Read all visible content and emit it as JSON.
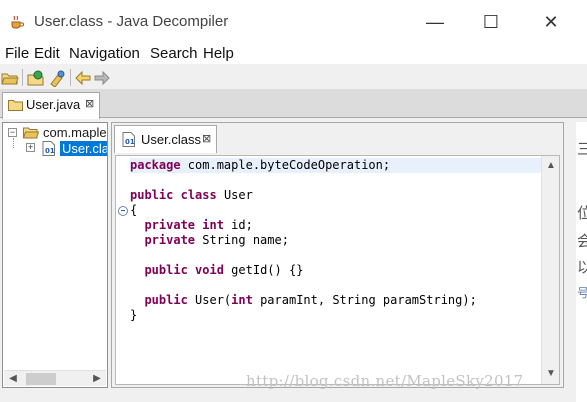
{
  "window": {
    "title": "User.class - Java Decompiler",
    "minimize": "—",
    "maximize": "☐",
    "close": "✕"
  },
  "menu": [
    "File",
    "Edit",
    "Navigation",
    "Search",
    "Help"
  ],
  "toolbar_icons": [
    "open-file-icon",
    "open-type-icon",
    "search-type-icon",
    "back-icon",
    "forward-icon"
  ],
  "editor_tab": {
    "label": "User.java",
    "close": "⊠"
  },
  "tree": {
    "package": "com.maple",
    "class_node": "User.class",
    "expander_collapsed": "+",
    "expander_expanded": "−"
  },
  "class_tab": {
    "label": "User.class",
    "close": "⊠"
  },
  "code": {
    "l1": {
      "kw": "package",
      "rest": " com.maple.byteCodeOperation;"
    },
    "l3": {
      "kw1": "public",
      "sp": " ",
      "kw2": "class",
      "rest": " User"
    },
    "l4": "{",
    "l5": {
      "indent": "  ",
      "kw1": "private",
      "sp": " ",
      "kw2": "int",
      "rest": " id;"
    },
    "l6": {
      "indent": "  ",
      "kw": "private",
      "rest": " String name;"
    },
    "l8": {
      "indent": "  ",
      "kw1": "public",
      "sp": " ",
      "kw2": "void",
      "rest": " getId() {}"
    },
    "l10": {
      "indent": "  ",
      "kw1": "public",
      "mid": " User(",
      "kw2": "int",
      "rest": " paramInt, String paramString);"
    },
    "l11": "}"
  },
  "scroll_arrows": {
    "up": "▲",
    "down": "▼",
    "left": "◀",
    "right": "▶"
  },
  "background_glyphs": [
    "三",
    "位",
    "会",
    "以",
    "号"
  ],
  "watermark": "http://blog.csdn.net/MapleSky2017",
  "colors": {
    "keyword": "#7f0055",
    "selection": "#0078d7",
    "current_line": "#e8f0fc"
  }
}
